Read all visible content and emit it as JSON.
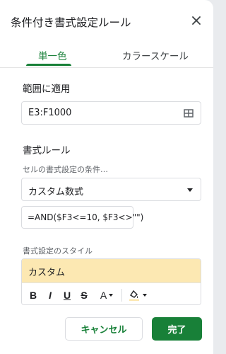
{
  "dialog": {
    "title": "条件付き書式設定ルール",
    "close_icon": "close-icon"
  },
  "tabs": [
    {
      "label": "単一色",
      "active": true
    },
    {
      "label": "カラースケール",
      "active": false
    }
  ],
  "range": {
    "label": "範囲に適用",
    "value": "E3:F1000",
    "icon": "grid-select-icon"
  },
  "format_rules": {
    "label": "書式ルール",
    "condition_label": "セルの書式設定の条件…",
    "condition_value": "カスタム数式",
    "formula_value": "=AND($F3<=10, $F3<>\"\")"
  },
  "style": {
    "label": "書式設定のスタイル",
    "preview_text": "カスタム",
    "preview_fill": "#fce8b2",
    "toolbar": {
      "bold": "B",
      "italic": "I",
      "underline": "U",
      "strikethrough": "S",
      "text_color": "A"
    }
  },
  "buttons": {
    "cancel": "キャンセル",
    "done": "完了"
  },
  "colors": {
    "accent": "#188038"
  }
}
